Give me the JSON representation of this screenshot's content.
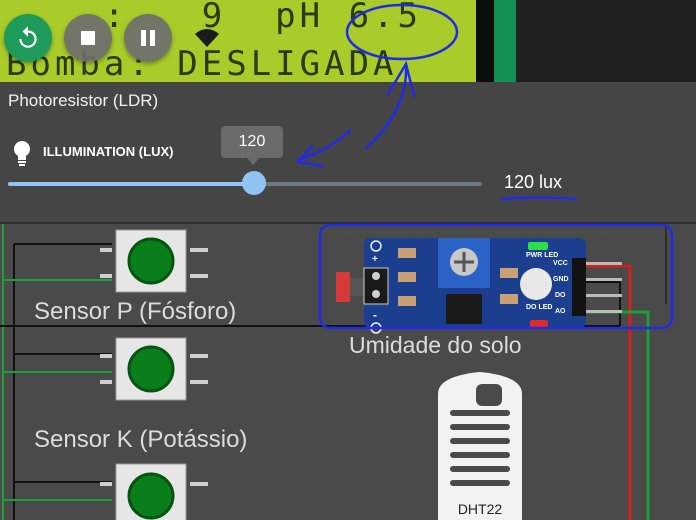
{
  "lcd": {
    "line1": "    :   9  pH 6.5",
    "line2": "Bomba: DESLIGADA",
    "bg_color": "#a9cc2a",
    "text_color": "#2b3a0a"
  },
  "controls": {
    "restart_icon": "restart-icon",
    "stop_icon": "stop-icon",
    "pause_icon": "pause-icon",
    "wifi_icon": "wifi-icon"
  },
  "photoresistor": {
    "title": "Photoresistor (LDR)",
    "illumination_label": "ILLUMINATION (LUX)",
    "tooltip_value": "120",
    "value_text": "120 lux",
    "slider_fraction": 0.52,
    "accent_color": "#90c4f2"
  },
  "circuit": {
    "label_p": "Sensor P (Fósforo)",
    "label_k": "Sensor K (Potássio)",
    "label_soil": "Umidade do solo",
    "dht_label": "DHT22",
    "module_pins": [
      "VCC",
      "GND",
      "DO",
      "AO"
    ],
    "led_labels": [
      "PWR LED",
      "DO LED"
    ],
    "pin_plus": "+",
    "pin_minus": "-"
  },
  "annotation_color": "#1f2be8"
}
